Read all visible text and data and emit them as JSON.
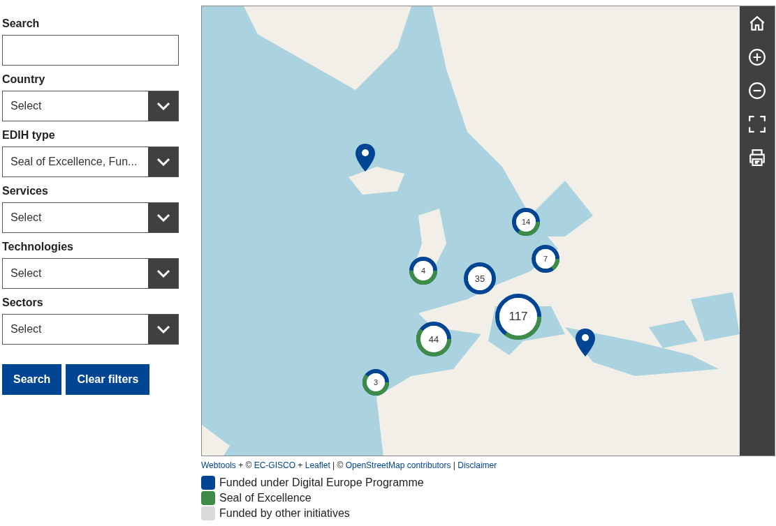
{
  "filters": [
    {
      "label": "Search",
      "kind": "text"
    },
    {
      "label": "Country",
      "kind": "select",
      "value": "Select"
    },
    {
      "label": "EDIH type",
      "kind": "select",
      "value": "Seal of Excellence, Fun..."
    },
    {
      "label": "Services",
      "kind": "select",
      "value": "Select"
    },
    {
      "label": "Technologies",
      "kind": "select",
      "value": "Select"
    },
    {
      "label": "Sectors",
      "kind": "select",
      "value": "Select"
    }
  ],
  "buttons": [
    "Search",
    "Clear filters"
  ],
  "map": {
    "kind": "picture",
    "clusters": [
      {
        "count": "14",
        "level": 0.35
      },
      {
        "count": "7",
        "level": 0.15
      },
      {
        "count": "4",
        "level": 0.5
      },
      {
        "count": "35",
        "level": 0
      },
      {
        "count": "117",
        "level": 0.35
      },
      {
        "count": "44",
        "level": 0.6
      },
      {
        "count": "3",
        "level": 0.6
      }
    ],
    "pins": [
      {
        "kind": "pin"
      },
      {
        "kind": "pin"
      }
    ],
    "toolbar": [
      {
        "kind": "home"
      },
      {
        "kind": "zoom-in"
      },
      {
        "kind": "zoom-out"
      },
      {
        "kind": "fullscreen"
      },
      {
        "kind": "print"
      }
    ]
  },
  "attribution": [
    {
      "text": "Webtools",
      "link": true
    },
    {
      "text": " + © ",
      "link": false
    },
    {
      "text": "EC-GISCO",
      "link": true
    },
    {
      "text": " + ",
      "link": false
    },
    {
      "text": "Leaflet",
      "link": true
    },
    {
      "text": " | © ",
      "link": false
    },
    {
      "text": "OpenStreetMap contributors",
      "link": true
    },
    {
      "text": " | ",
      "link": false
    },
    {
      "text": "Disclaimer",
      "link": true
    }
  ],
  "legend": [
    {
      "label": "Funded under Digital Europe Programme",
      "color": "#004494"
    },
    {
      "label": "Seal of Excellence",
      "color": "#3e8a47"
    },
    {
      "label": "Funded by other initiatives",
      "color": "#d9d9d9"
    }
  ]
}
